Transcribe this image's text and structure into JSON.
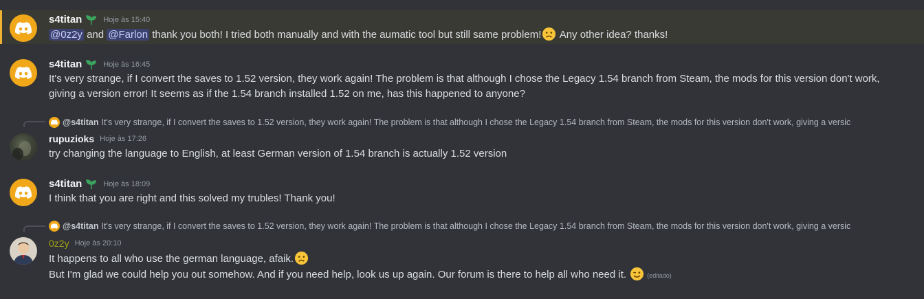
{
  "colors": {
    "background": "#313338",
    "highlight_bar": "#f0b232",
    "mention_bg": "#3c4270",
    "discord_avatar": "#f0a81a",
    "username_green": "#a3a312"
  },
  "messages": [
    {
      "author": "s4titan",
      "badge": "sprout-icon",
      "timestamp": "Hoje às 15:40",
      "mention1": "@0z2y",
      "and": "and",
      "mention2": "@Farlon",
      "text_a": "thank you both! I tried both manually and with the aumatic tool but still same problem!",
      "text_b": "Any other idea? thanks!"
    },
    {
      "author": "s4titan",
      "timestamp": "Hoje às 16:45",
      "line1": "It's very strange, if I convert the saves to 1.52 version, they work again! The problem is that although I chose the Legacy 1.54 branch from Steam, the mods for this version don't work,",
      "line2": "giving a version error! It seems as if the 1.54 branch installed 1.52 on me, has this happened to anyone?"
    },
    {
      "reply_name": "@s4titan",
      "reply_text": "It's very strange, if I convert the saves to 1.52 version, they work again! The problem is that although I chose the Legacy 1.54 branch from Steam, the mods for this version don't work, giving a versic",
      "author": "rupuzioks",
      "timestamp": "Hoje às 17:26",
      "text": "try changing the language to English, at least German version of 1.54 branch is actually 1.52 version"
    },
    {
      "author": "s4titan",
      "timestamp": "Hoje às 18:09",
      "text": "I think that you are right and this solved my trubles! Thank you!"
    },
    {
      "reply_name": "@s4titan",
      "reply_text": "It's very strange, if I convert the saves to 1.52 version, they work again! The problem is that although I chose the Legacy 1.54 branch from Steam, the mods for this version don't work, giving a versic",
      "author": "0z2y",
      "timestamp": "Hoje às 20:10",
      "line1": "It happens to all who use the german language, afaik.",
      "line2": "But I'm glad we could help you out somehow. And if you need help, look us up again. Our forum is there to help all who need it.",
      "edited": "(editado)"
    }
  ]
}
